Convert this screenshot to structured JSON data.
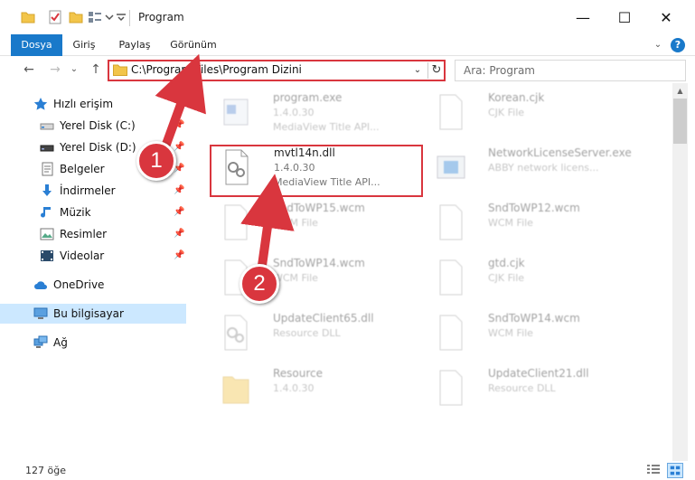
{
  "window": {
    "title": "Program",
    "minimize": "—",
    "maximize": "☐",
    "close": "✕"
  },
  "ribbon": {
    "tabs": [
      "Dosya",
      "Giriş",
      "Paylaş",
      "Görünüm"
    ],
    "help": "?",
    "chevron": "⌄"
  },
  "nav": {
    "back": "←",
    "forward": "→",
    "history": "⌄",
    "up": "↑",
    "address": "C:\\Program Files\\Program Dizini",
    "search_placeholder": "Ara: Program",
    "dropdown": "⌄",
    "refresh": "↻"
  },
  "sidebar": {
    "items": [
      {
        "label": "Hızlı erişim",
        "icon": "star-icon"
      },
      {
        "label": "Yerel Disk (C:)",
        "icon": "drive-icon",
        "pinned": true
      },
      {
        "label": "Yerel Disk (D:)",
        "icon": "drive-icon",
        "pinned": true
      },
      {
        "label": "Belgeler",
        "icon": "documents-icon",
        "pinned": true
      },
      {
        "label": "İndirmeler",
        "icon": "download-icon",
        "pinned": true
      },
      {
        "label": "Müzik",
        "icon": "music-icon",
        "pinned": true
      },
      {
        "label": "Resimler",
        "icon": "pictures-icon",
        "pinned": true
      },
      {
        "label": "Videolar",
        "icon": "videos-icon",
        "pinned": true
      },
      {
        "label": "OneDrive",
        "icon": "cloud-icon"
      },
      {
        "label": "Bu bilgisayar",
        "icon": "computer-icon"
      },
      {
        "label": "Ağ",
        "icon": "network-icon"
      }
    ]
  },
  "files": [
    {
      "name": "program.exe",
      "line2": "1.4.0.30",
      "line3": "MediaView Title API...",
      "icon": "exe-icon"
    },
    {
      "name": "Korean.cjk",
      "line2": "CJK File",
      "line3": "",
      "icon": "generic-file-icon"
    },
    {
      "name": "mvtl14n.dll",
      "line2": "1.4.0.30",
      "line3": "MediaView Title API...",
      "icon": "dll-icon"
    },
    {
      "name": "NetworkLicenseServer.exe",
      "line2": "ABBY network licens...",
      "line3": "",
      "icon": "app-window-icon"
    },
    {
      "name": "SndToWP15.wcm",
      "line2": "WCM File",
      "line3": "",
      "icon": "generic-file-icon"
    },
    {
      "name": "SndToWP12.wcm",
      "line2": "WCM File",
      "line3": "",
      "icon": "generic-file-icon"
    },
    {
      "name": "SndToWP14.wcm",
      "line2": "WCM File",
      "line3": "",
      "icon": "generic-file-icon"
    },
    {
      "name": "gtd.cjk",
      "line2": "CJK File",
      "line3": "",
      "icon": "generic-file-icon"
    },
    {
      "name": "UpdateClient65.dll",
      "line2": "Resource DLL",
      "line3": "",
      "icon": "dll-icon"
    },
    {
      "name": "SndToWP14.wcm",
      "line2": "WCM File",
      "line3": "",
      "icon": "generic-file-icon"
    },
    {
      "name": "Resource",
      "line2": "1.4.0.30",
      "line3": "",
      "icon": "folder-file-icon"
    },
    {
      "name": "UpdateClient21.dll",
      "line2": "Resource DLL",
      "line3": "",
      "icon": "dll-icon"
    }
  ],
  "status": {
    "count": "127 öğe"
  },
  "annotations": {
    "badge1": "1",
    "badge2": "2"
  },
  "colors": {
    "accent": "#1979ca",
    "highlight_red": "#d9363e",
    "selection": "#cce8ff"
  }
}
